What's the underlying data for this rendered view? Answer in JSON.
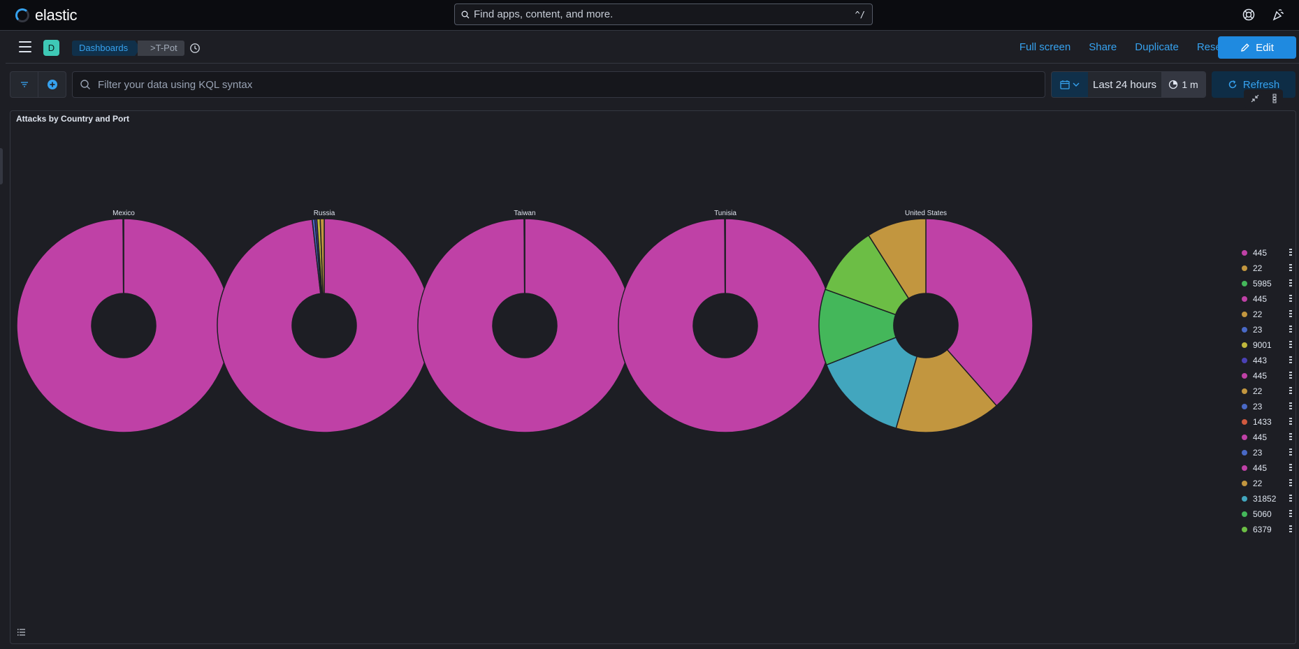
{
  "header": {
    "logo_text": "elastic",
    "search_placeholder": "Find apps, content, and more.",
    "search_shortcut": "^/"
  },
  "subheader": {
    "space_initial": "D",
    "breadcrumbs": [
      "Dashboards",
      ">T-Pot"
    ],
    "actions": [
      "Full screen",
      "Share",
      "Duplicate",
      "Reset"
    ],
    "edit_label": "Edit"
  },
  "querybar": {
    "kql_placeholder": "Filter your data using KQL syntax",
    "time_range": "Last 24 hours",
    "refresh_interval": "1 m",
    "refresh_label": "Refresh"
  },
  "panel": {
    "title": "Attacks by Country and Port"
  },
  "colors": {
    "445": "#bf41a6",
    "22": "#c2963f",
    "5985": "#44b75a",
    "23": "#4969c6",
    "9001": "#c0b73c",
    "443": "#4a41b5",
    "1433": "#d0593f",
    "31852": "#42a6be",
    "5060": "#44b75a",
    "6379": "#6cbe45"
  },
  "legend": [
    "445",
    "22",
    "5985",
    "445",
    "22",
    "23",
    "9001",
    "443",
    "445",
    "22",
    "23",
    "1433",
    "445",
    "23",
    "445",
    "22",
    "31852",
    "5060",
    "6379"
  ],
  "chart_data": {
    "type": "pie",
    "donut": true,
    "title": "Attacks by Country and Port",
    "pies": [
      {
        "name": "Mexico",
        "slices": [
          {
            "label": "445",
            "value": 99.9
          },
          {
            "label": "22",
            "value": 0.1
          }
        ]
      },
      {
        "name": "Russia",
        "slices": [
          {
            "label": "445",
            "value": 98.2
          },
          {
            "label": "23",
            "value": 0.4
          },
          {
            "label": "443",
            "value": 0.3
          },
          {
            "label": "9001",
            "value": 0.5
          },
          {
            "label": "22",
            "value": 0.6
          }
        ]
      },
      {
        "name": "Taiwan",
        "slices": [
          {
            "label": "445",
            "value": 99.9
          },
          {
            "label": "22",
            "value": 0.1
          }
        ]
      },
      {
        "name": "Tunisia",
        "slices": [
          {
            "label": "445",
            "value": 99.9
          },
          {
            "label": "23",
            "value": 0.1
          }
        ]
      },
      {
        "name": "United States",
        "slices": [
          {
            "label": "445",
            "value": 38.5
          },
          {
            "label": "22",
            "value": 16.0
          },
          {
            "label": "31852",
            "value": 14.5
          },
          {
            "label": "5060",
            "value": 11.5
          },
          {
            "label": "6379",
            "value": 10.5
          },
          {
            "label": "22",
            "value": 9.0
          }
        ]
      }
    ]
  }
}
